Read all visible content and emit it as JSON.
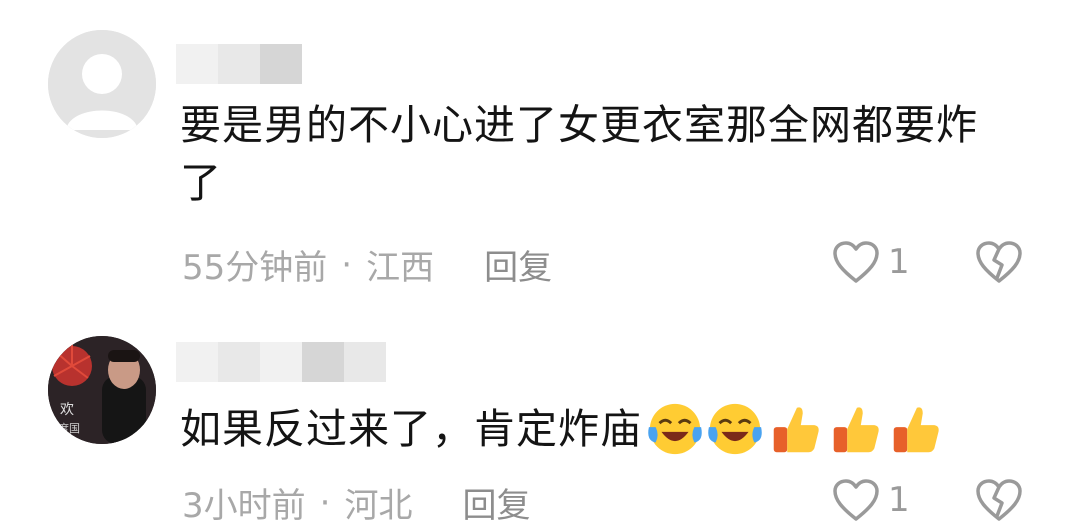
{
  "comments": [
    {
      "text": "要是男的不小心进了女更衣室那全网都要炸了",
      "time": "55分钟前",
      "separator": "·",
      "location": "江西",
      "reply_label": "回复",
      "likes": "1"
    },
    {
      "text": "如果反过来了，肯定炸庙",
      "emojis": [
        "laughing-crying-icon",
        "laughing-crying-icon",
        "thumbs-up-icon",
        "thumbs-up-icon",
        "thumbs-up-icon"
      ],
      "time": "3小时前",
      "separator": "·",
      "location": "河北",
      "reply_label": "回复",
      "likes": "1"
    }
  ]
}
